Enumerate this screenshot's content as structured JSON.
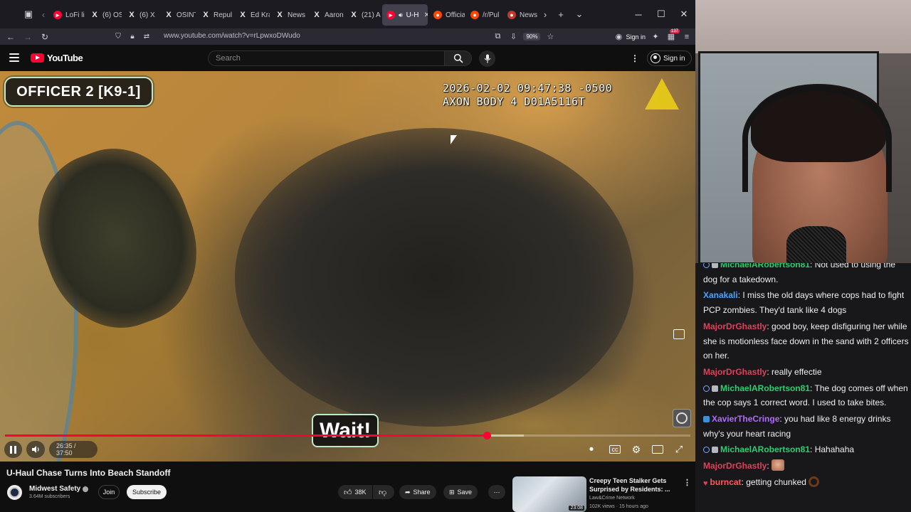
{
  "browser": {
    "tabs": [
      {
        "label": "LoFi li",
        "icon": "youtube-icon",
        "active": false
      },
      {
        "label": "(6) OS",
        "icon": "x-icon",
        "active": false
      },
      {
        "label": "(6) X",
        "icon": "x-icon",
        "active": false
      },
      {
        "label": "OSINT",
        "icon": "x-icon",
        "active": false
      },
      {
        "label": "Repul",
        "icon": "x-icon",
        "active": false
      },
      {
        "label": "Ed Kra",
        "icon": "x-icon",
        "active": false
      },
      {
        "label": "News",
        "icon": "x-icon",
        "active": false
      },
      {
        "label": "Aaron",
        "icon": "x-icon",
        "active": false
      },
      {
        "label": "(21) A",
        "icon": "x-icon",
        "active": false
      },
      {
        "label": "U-H",
        "icon": "youtube-icon",
        "active": true
      },
      {
        "label": "Officia",
        "icon": "reddit-icon",
        "active": false
      },
      {
        "label": "/r/Pul",
        "icon": "reddit-icon",
        "active": false
      },
      {
        "label": "News",
        "icon": "news-icon",
        "active": false
      }
    ],
    "url": "www.youtube.com/watch?v=rLpwxoDWudo",
    "zoom": "90%",
    "signin_label": "Sign in",
    "extensions_badge": "137"
  },
  "youtube": {
    "logo_text": "YouTube",
    "search_placeholder": "Search",
    "signin_label": "Sign in"
  },
  "video": {
    "officer_label": "OFFICER 2 [K9-1]",
    "axon_line1": "2026-02-02 09:47:38 -0500",
    "axon_line2": "AXON BODY 4 D01A5116T",
    "caption": "Wait!",
    "time_text": "26:35 / 37:50",
    "progress_played": 0.7026,
    "progress_loaded": 0.7567,
    "title": "U-Haul Chase Turns Into Beach Standoff"
  },
  "channel": {
    "name": "Midwest Safety",
    "subscribers": "3.64M subscribers",
    "join_label": "Join",
    "subscribe_label": "Subscribe"
  },
  "actions": {
    "likes": "38K",
    "share_label": "Share",
    "save_label": "Save"
  },
  "recommended": {
    "title_line1": "Creepy Teen Stalker Gets",
    "title_line2": "Surprised by Residents: ...",
    "channel": "Law&Crime Network",
    "meta": "102K views · 15 hours ago",
    "duration": "23:08"
  },
  "chat": {
    "messages": [
      {
        "badges": [
          "user",
          "mod"
        ],
        "user": "MichaelARobertson81",
        "color": "#2ecc71",
        "text": ": Not used to using the dog for a takedown."
      },
      {
        "badges": [],
        "user": "Xanakali",
        "color": "#4aa3ff",
        "text": ": I miss the old days where cops had to fight PCP zombies. They'd tank like 4 dogs"
      },
      {
        "badges": [],
        "user": "MajorDrGhastly",
        "color": "#e0405a",
        "text": ": good boy, keep disfiguring her while she is motionless face down in the sand with 2 officers on her."
      },
      {
        "badges": [],
        "user": "MajorDrGhastly",
        "color": "#e0405a",
        "text": ": really effectie"
      },
      {
        "badges": [
          "user",
          "mod"
        ],
        "user": "MichaelARobertson81",
        "color": "#2ecc71",
        "text": ": The dog comes off when the cop says 1 correct word. I used to take bites."
      },
      {
        "badges": [
          "prime"
        ],
        "user": "XavierTheCringe",
        "color": "#b06bff",
        "text": ": you had like 8 energy drinks why's your heart racing"
      },
      {
        "badges": [
          "user",
          "mod"
        ],
        "user": "MichaelARobertson81",
        "color": "#2ecc71",
        "text": ": Hahahaha"
      },
      {
        "badges": [],
        "user": "MajorDrGhastly",
        "color": "#e0405a",
        "text": ":",
        "emote": "face"
      },
      {
        "badges": [
          "heart"
        ],
        "user": "burncat",
        "color": "#ff5a5a",
        "text": ": getting chunked",
        "emote": "ring"
      }
    ]
  }
}
